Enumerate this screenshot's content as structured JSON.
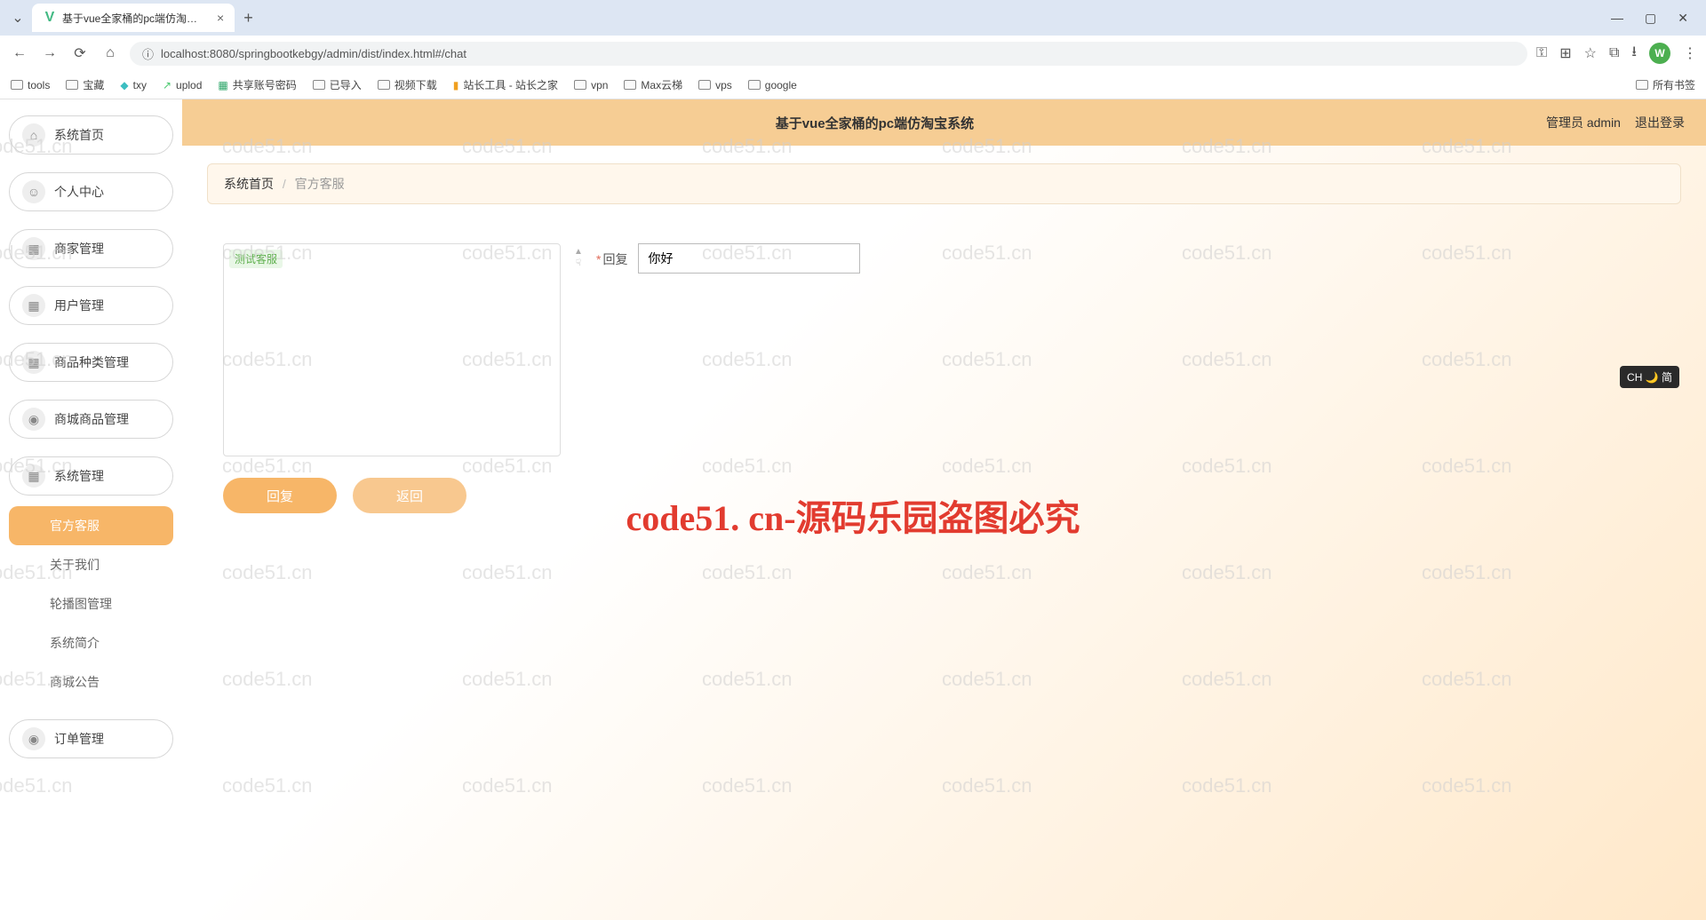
{
  "browser": {
    "tab_title": "基于vue全家桶的pc端仿淘宝系",
    "url": "localhost:8080/springbootkebgy/admin/dist/index.html#/chat",
    "window_controls": {
      "min": "—",
      "max": "▢",
      "close": "✕"
    },
    "bookmarks": [
      "tools",
      "宝藏",
      "txy",
      "uplod",
      "共享账号密码",
      "已导入",
      "视频下载",
      "站长工具 - 站长之家",
      "vpn",
      "Max云梯",
      "vps",
      "google"
    ],
    "all_bookmarks": "所有书签"
  },
  "app": {
    "title": "基于vue全家桶的pc端仿淘宝系统",
    "admin_label": "管理员 admin",
    "logout": "退出登录"
  },
  "sidebar": {
    "items": [
      "系统首页",
      "个人中心",
      "商家管理",
      "用户管理",
      "商品种类管理",
      "商城商品管理",
      "系统管理"
    ],
    "sub_items": [
      "官方客服",
      "关于我们",
      "轮播图管理",
      "系统简介",
      "商城公告"
    ],
    "last_item": "订单管理"
  },
  "breadcrumb": {
    "home": "系统首页",
    "current": "官方客服"
  },
  "form": {
    "chat_tag": "测试客服",
    "reply_label": "回复",
    "reply_value": "你好",
    "submit": "回复",
    "back": "返回"
  },
  "watermark": {
    "small": "code51.cn",
    "big": "code51. cn-源码乐园盗图必究"
  },
  "ime": "CH 🌙 简"
}
